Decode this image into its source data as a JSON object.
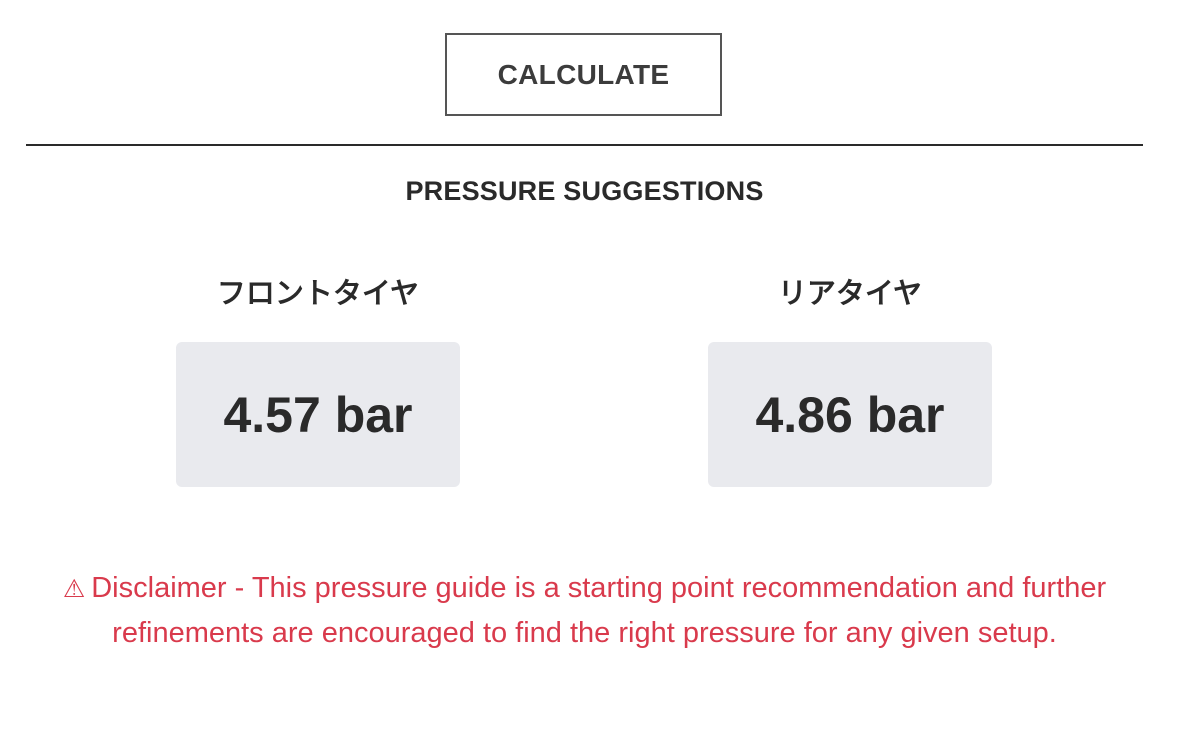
{
  "actions": {
    "calculate_label": "CALCULATE"
  },
  "results": {
    "title": "PRESSURE SUGGESTIONS",
    "front": {
      "label": "フロントタイヤ",
      "value": "4.57 bar"
    },
    "rear": {
      "label": "リアタイヤ",
      "value": "4.86 bar"
    }
  },
  "disclaimer": {
    "icon": "warning-triangle-icon",
    "glyph": "⚠",
    "text": "Disclaimer - This pressure guide is a starting point recommendation and further refinements are encouraged to find the right pressure for any given setup."
  },
  "colors": {
    "disclaimer": "#d93a4c",
    "value_box_bg": "#e9eaee",
    "text_dark": "#2a2a2a"
  }
}
